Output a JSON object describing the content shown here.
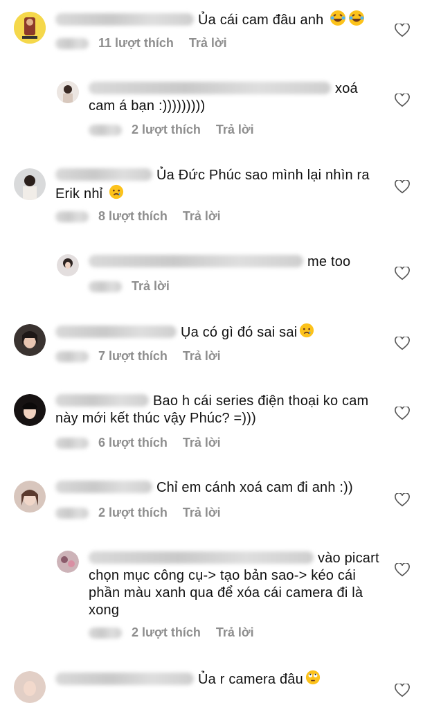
{
  "comments": [
    {
      "text": "Ủa cái cam đâu anh",
      "likes": "11 lượt thích",
      "reply": "Trả lời"
    },
    {
      "text": "xoá cam á bạn :)))))))))",
      "likes": "2 lượt thích",
      "reply": "Trả lời"
    },
    {
      "text": "Ủa Đức Phúc sao mình lại nhìn ra Erik nhỉ",
      "likes": "8 lượt thích",
      "reply": "Trả lời"
    },
    {
      "text": "me too",
      "reply": "Trả lời"
    },
    {
      "text": "Ụa có gì đó sai sai",
      "likes": "7 lượt thích",
      "reply": "Trả lời"
    },
    {
      "text": "Bao h cái series điện thoại ko cam này mới kết thúc vậy Phúc? =)))",
      "likes": "6 lượt thích",
      "reply": "Trả lời"
    },
    {
      "text": "Chỉ em cánh xoá cam đi anh :))",
      "likes": "2 lượt thích",
      "reply": "Trả lời"
    },
    {
      "text": "vào picart chọn mục công cụ-> tạo bản sao-> kéo cái phần màu xanh qua để xóa cái camera đi là xong",
      "likes": "2 lượt thích",
      "reply": "Trả lời"
    },
    {
      "text": "Ủa r camera đâu"
    }
  ],
  "icons": {
    "like": "heart-outline-icon"
  },
  "colors": {
    "meta": "#8e8e8e",
    "text": "#111111"
  }
}
